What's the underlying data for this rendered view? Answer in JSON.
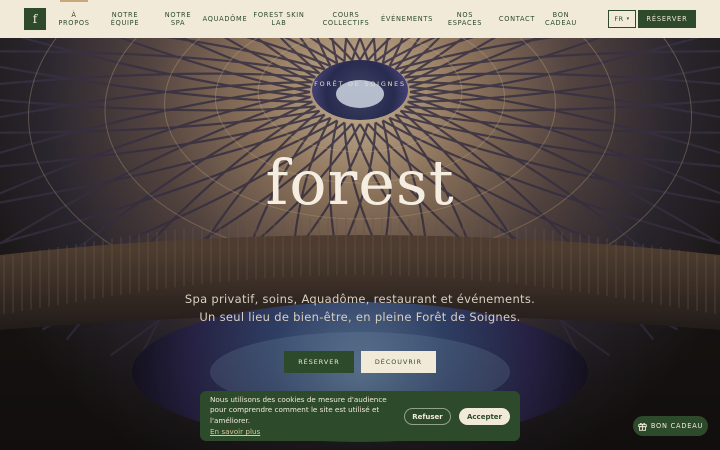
{
  "header": {
    "logo_letter": "f",
    "nav": [
      {
        "label": "À\nPROPOS",
        "lines": [
          "À",
          "PROPOS"
        ],
        "active": true
      },
      {
        "label": "NOTRE ÉQUIPE",
        "lines": [
          "NOTRE",
          "ÉQUIPE"
        ]
      },
      {
        "label": "NOTRE SPA",
        "lines": [
          "NOTRE",
          "SPA"
        ]
      },
      {
        "label": "AQUADÔME",
        "lines": [
          "AQUADÔME"
        ]
      },
      {
        "label": "FOREST SKIN LAB",
        "lines": [
          "FOREST SKIN",
          "LAB"
        ]
      },
      {
        "label": "COURS COLLECTIFS",
        "lines": [
          "COURS",
          "COLLECTIFS"
        ]
      },
      {
        "label": "ÉVÉNEMENTS",
        "lines": [
          "ÉVÉNEMENTS"
        ]
      },
      {
        "label": "NOS ESPACES",
        "lines": [
          "NOS",
          "ESPACES"
        ]
      },
      {
        "label": "CONTACT",
        "lines": [
          "CONTACT"
        ]
      },
      {
        "label": "BON CADEAU",
        "lines": [
          "BON",
          "CADEAU"
        ]
      }
    ],
    "language": "FR",
    "language_caret": "▾",
    "reserve_label": "RÉSERVER"
  },
  "hero": {
    "location": "FORÊT DE SOIGNES",
    "brand": "forest",
    "tagline": "Spa privatif, soins, Aquadôme, restaurant et événements. Un seul lieu de bien-être, en pleine Forêt de Soignes.",
    "reserve_label": "RÉSERVER",
    "discover_label": "DÉCOUVRIR"
  },
  "cookie_banner": {
    "text": "Nous utilisons des cookies de mesure d'audience pour comprendre comment le site est utilisé et l'améliorer.",
    "link": "En savoir plus",
    "refuse_label": "Refuser",
    "accept_label": "Accepter"
  },
  "gift_button": {
    "label": "BON CADEAU",
    "icon": "gift-icon"
  },
  "colors": {
    "brand_green": "#2d4a2a",
    "cream": "#f1ead9",
    "gold": "#c9a87a"
  }
}
